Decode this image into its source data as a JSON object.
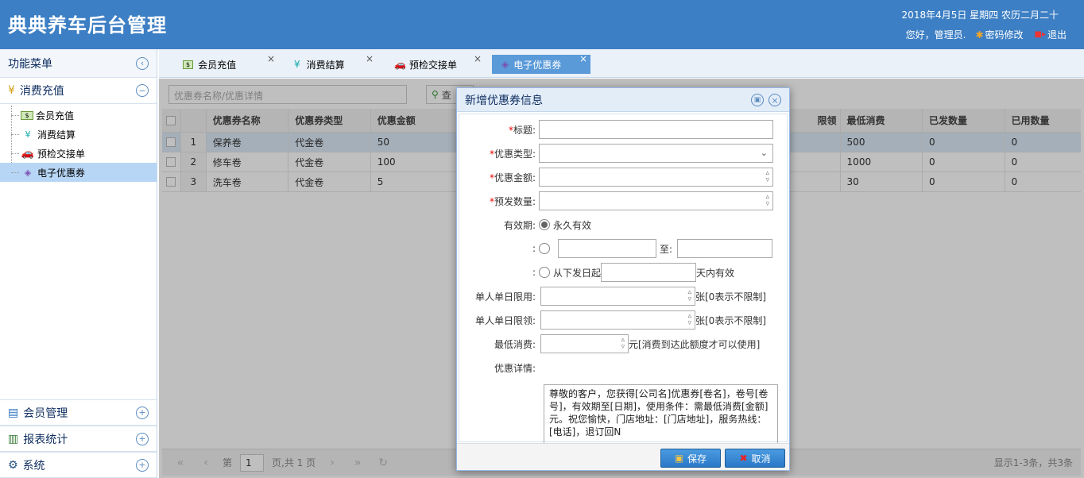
{
  "header": {
    "logo": "典典养车后台管理",
    "date": "2018年4月5日 星期四 农历二月二十",
    "greeting": "您好，管理员.",
    "change_password": "密码修改",
    "logout": "退出"
  },
  "sidebar": {
    "title": "功能菜单",
    "group_open": "消费充值",
    "items": [
      {
        "label": "会员充值"
      },
      {
        "label": "消费结算"
      },
      {
        "label": "预检交接单"
      },
      {
        "label": "电子优惠券"
      }
    ],
    "bottom_groups": [
      {
        "label": "会员管理"
      },
      {
        "label": "报表统计"
      },
      {
        "label": "系统"
      }
    ]
  },
  "tabs": [
    {
      "label": "会员充值"
    },
    {
      "label": "消费结算"
    },
    {
      "label": "预检交接单"
    },
    {
      "label": "电子优惠券"
    }
  ],
  "search": {
    "placeholder": "优惠券名称/优惠详情",
    "button": "查"
  },
  "table": {
    "headers_left": [
      "优惠券名称",
      "优惠券类型",
      "优惠金额"
    ],
    "header_partial": "限领",
    "headers_right": [
      "最低消费",
      "已发数量",
      "已用数量"
    ],
    "rows": [
      {
        "no": "1",
        "name": "保养卷",
        "type": "代金卷",
        "amount": "50",
        "min": "500",
        "sent": "0",
        "used": "0"
      },
      {
        "no": "2",
        "name": "修车卷",
        "type": "代金卷",
        "amount": "100",
        "min": "1000",
        "sent": "0",
        "used": "0"
      },
      {
        "no": "3",
        "name": "洗车卷",
        "type": "代金卷",
        "amount": "5",
        "min": "30",
        "sent": "0",
        "used": "0"
      }
    ]
  },
  "pager": {
    "page_prefix": "第",
    "page_value": "1",
    "page_suffix": "页,共 1 页",
    "info": "显示1-3条，共3条"
  },
  "dialog": {
    "title": "新增优惠券信息",
    "fields": {
      "title_label": "标题:",
      "type_label": "优惠类型:",
      "amount_label": "优惠金额:",
      "qty_label": "预发数量:",
      "valid_label": "有效期:",
      "valid_forever": "永久有效",
      "range_to": "至:",
      "from_issue": "从下发日起",
      "days_valid": "天内有效",
      "use_limit_label": "单人单日限用:",
      "use_limit_suffix": "张[0表示不限制]",
      "claim_limit_label": "单人单日限领:",
      "claim_limit_suffix": "张[0表示不限制]",
      "min_spend_label": "最低消费:",
      "min_spend_suffix": "元[消费到达此额度才可以使用]",
      "detail_label": "优惠详情:",
      "detail_value": "尊敬的客户，您获得[公司名]优惠券[卷名]，卷号[卷号]，有效期至[日期]，使用条件：需最低消费[金额]元。祝您愉快，门店地址：[门店地址]，服务热线：[电话]，退订回N"
    },
    "save": "保存",
    "cancel": "取消"
  }
}
